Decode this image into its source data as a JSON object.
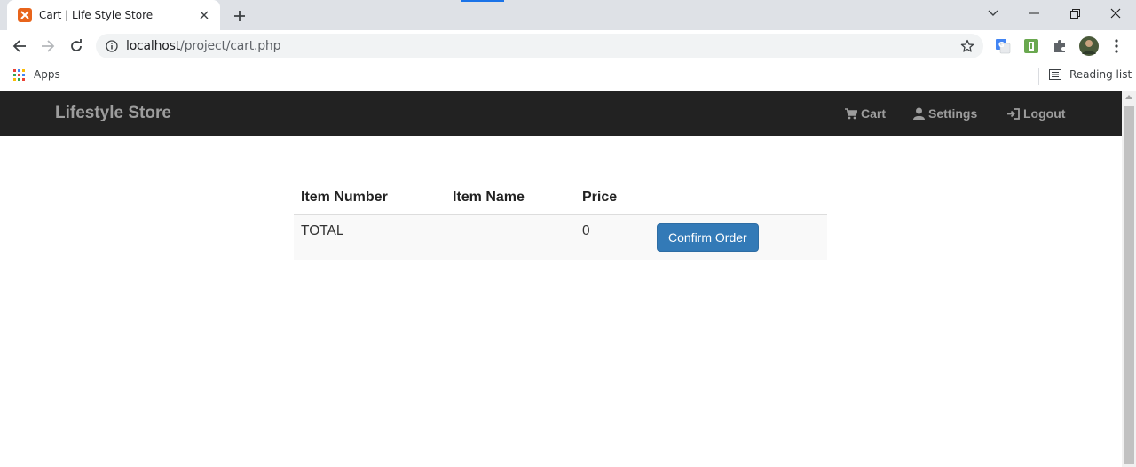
{
  "browser": {
    "tab_title": "Cart | Life Style Store",
    "url_host": "localhost",
    "url_path": "/project/cart.php",
    "bookmarks": {
      "apps_label": "Apps",
      "reading_list_label": "Reading list"
    }
  },
  "site": {
    "brand": "Lifestyle Store",
    "nav": [
      {
        "label": "Cart",
        "icon": "shopping-cart-icon"
      },
      {
        "label": "Settings",
        "icon": "user-icon"
      },
      {
        "label": "Logout",
        "icon": "logout-icon"
      }
    ]
  },
  "cart": {
    "headers": [
      "Item Number",
      "Item Name",
      "Price"
    ],
    "total_row": {
      "label": "TOTAL",
      "name": "",
      "price": "0",
      "button_label": "Confirm Order"
    }
  },
  "colors": {
    "navbar_bg": "#222222",
    "nav_text": "#9d9d9d",
    "primary_button": "#337ab7",
    "favicon": "#e8641b"
  }
}
